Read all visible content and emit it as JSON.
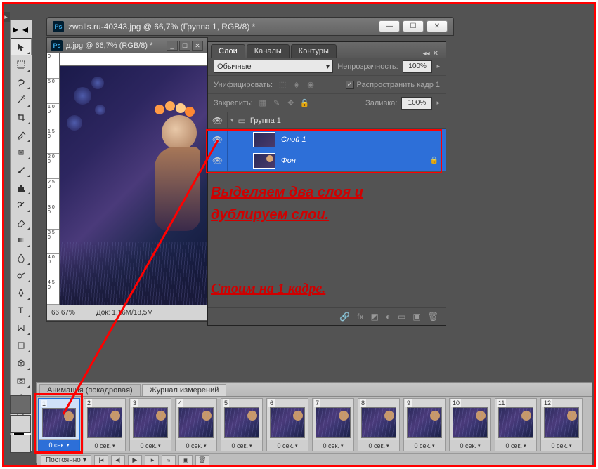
{
  "doc1": {
    "title": "zwalls.ru-40343.jpg @ 66,7% (Группа 1, RGB/8) *"
  },
  "doc2": {
    "title": "д.jpg @ 66,7% (RGB/8) *",
    "zoom": "66,67%",
    "docinfo": "Док: 1,16M/18,5M",
    "ruler_v": [
      "0",
      "5 0",
      "1 0 0",
      "1 5 0",
      "2 0 0",
      "2 5 0",
      "3 0 0",
      "3 5 0",
      "4 0 0",
      "4 5 0"
    ]
  },
  "layers": {
    "tabs": [
      "Слои",
      "Каналы",
      "Контуры"
    ],
    "blend_mode": "Обычные",
    "opacity_label": "Непрозрачность:",
    "opacity_value": "100%",
    "unify_label": "Унифицировать:",
    "propagate_label": "Распространить кадр 1",
    "lock_label": "Закрепить:",
    "fill_label": "Заливка:",
    "fill_value": "100%",
    "group": "Группа 1",
    "items": [
      {
        "name": "Слой 1"
      },
      {
        "name": "Фон"
      }
    ]
  },
  "annotation1_line1": "Выделяем два слоя и",
  "annotation1_line2": "дублируем  слои.",
  "annotation2": "Стоим на 1 кадре.",
  "animation": {
    "tabs": [
      "Анимация (покадровая)",
      "Журнал измерений"
    ],
    "loop": "Постоянно",
    "frames": [
      {
        "n": "1",
        "t": "0 сек."
      },
      {
        "n": "2",
        "t": "0 сек."
      },
      {
        "n": "3",
        "t": "0 сек."
      },
      {
        "n": "4",
        "t": "0 сек."
      },
      {
        "n": "5",
        "t": "0 сек."
      },
      {
        "n": "6",
        "t": "0 сек."
      },
      {
        "n": "7",
        "t": "0 сек."
      },
      {
        "n": "8",
        "t": "0 сек."
      },
      {
        "n": "9",
        "t": "0 сек."
      },
      {
        "n": "10",
        "t": "0 сек."
      },
      {
        "n": "11",
        "t": "0 сек."
      },
      {
        "n": "12",
        "t": "0 сек."
      }
    ]
  },
  "icons": {
    "ps": "Ps",
    "min": "—",
    "max": "☐",
    "close": "✕",
    "eye": "👁",
    "lock": "🔒",
    "chevdown": "▾",
    "triright": "▸",
    "folder": "📁",
    "link": "🔗",
    "fx": "fx",
    "mask": "◩",
    "adj": "◐",
    "group": "▭",
    "new": "▣",
    "trash": "🗑"
  }
}
